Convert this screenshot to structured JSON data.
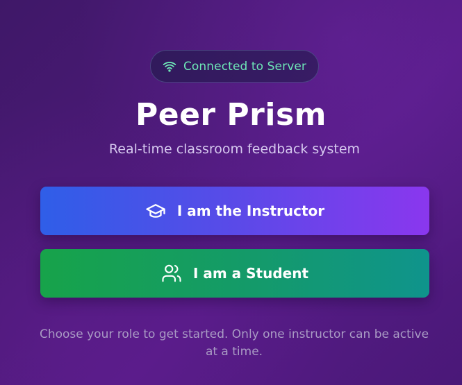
{
  "status": {
    "text": "Connected to Server",
    "icon": "wifi-icon",
    "color": "#6ee7b7"
  },
  "header": {
    "title": "Peer Prism",
    "subtitle": "Real-time classroom feedback system"
  },
  "roles": {
    "instructor": {
      "label": "I am the Instructor",
      "icon": "graduation-cap-icon",
      "gradient": [
        "#2f5ee8",
        "#8a37ee"
      ]
    },
    "student": {
      "label": "I am a Student",
      "icon": "users-icon",
      "gradient": [
        "#17a34a",
        "#0f948c"
      ]
    }
  },
  "footer": {
    "note": "Choose your role to get started. Only one instructor can be active at a time."
  },
  "theme": {
    "background": "#4c1a78"
  }
}
